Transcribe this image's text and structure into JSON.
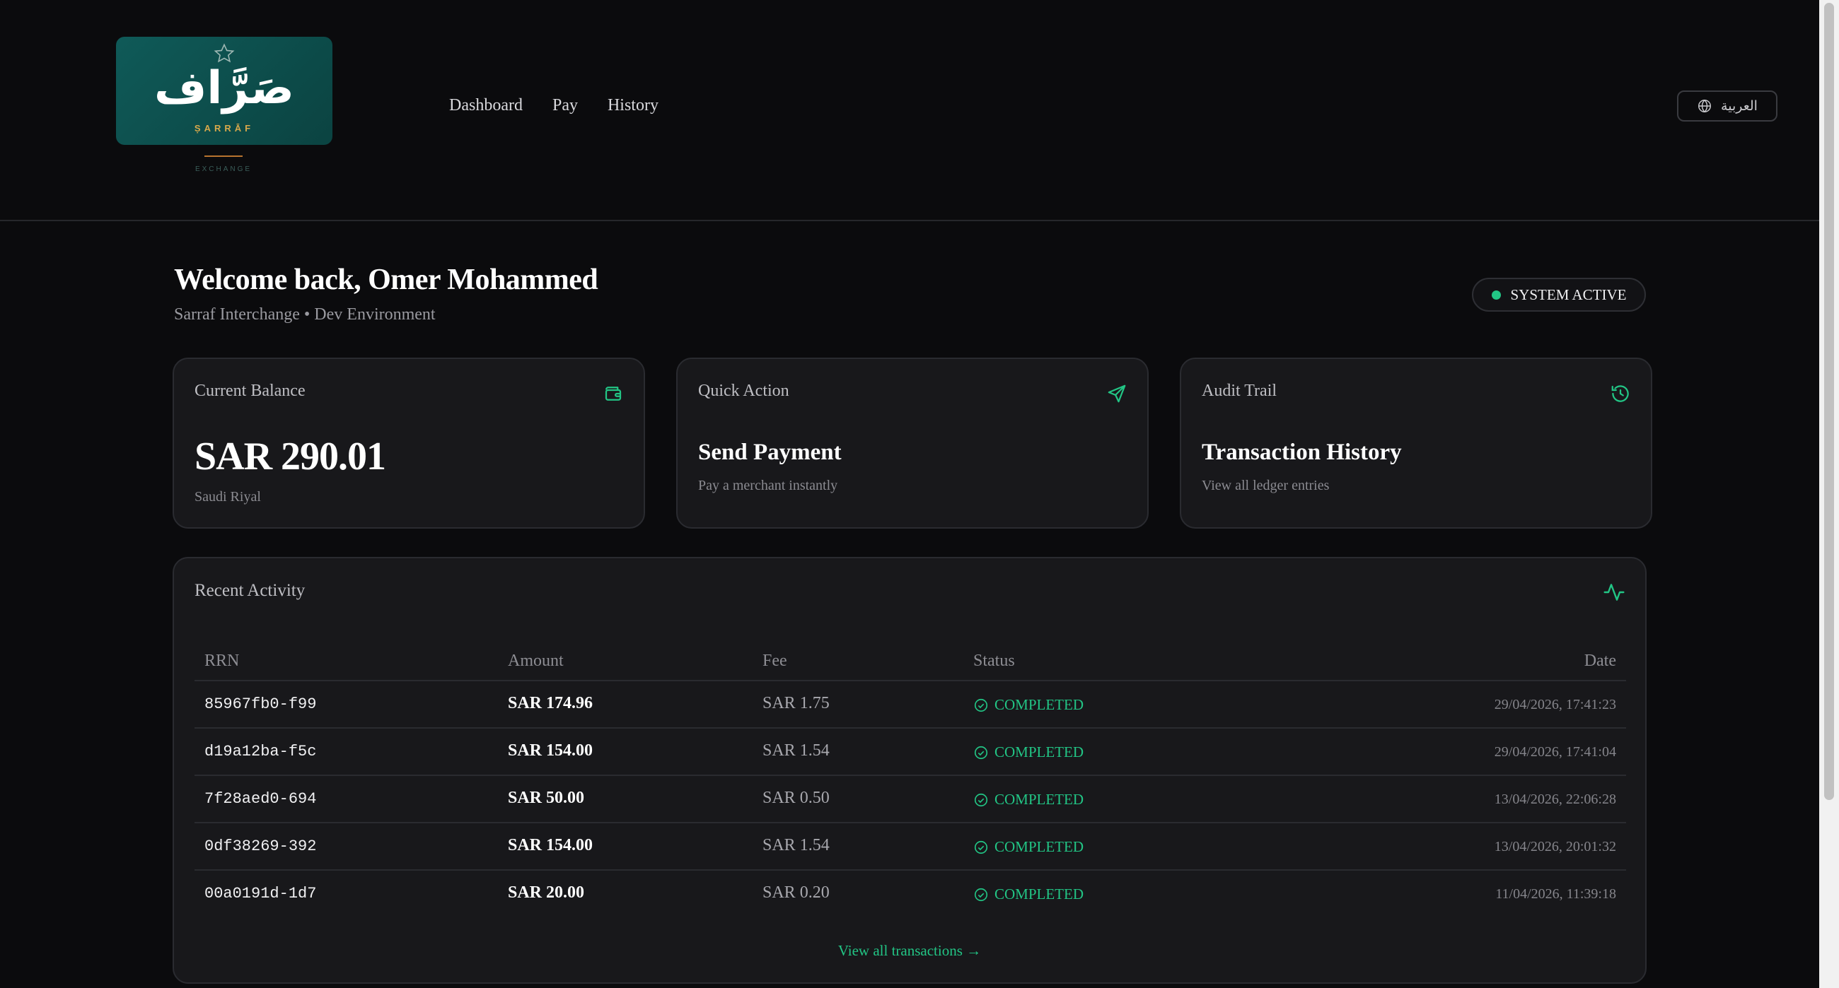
{
  "brand": {
    "arabic": "صَرَّاف",
    "latin": "ṢARRĀF",
    "tagline": "EXCHANGE",
    "card_color": "#0f5a58"
  },
  "nav": {
    "items": [
      {
        "label": "Dashboard"
      },
      {
        "label": "Pay"
      },
      {
        "label": "History"
      }
    ]
  },
  "language_button": {
    "label": "العربية",
    "icon": "globe-icon"
  },
  "welcome": {
    "title": "Welcome back, Omer Mohammed",
    "subtitle": "Sarraf Interchange • Dev Environment"
  },
  "system_status": {
    "label": "SYSTEM ACTIVE",
    "color": "#22c585"
  },
  "cards": {
    "balance": {
      "label": "Current Balance",
      "value": "SAR 290.01",
      "currency": "Saudi Riyal",
      "icon": "wallet-icon"
    },
    "quick_action": {
      "label": "Quick Action",
      "title": "Send Payment",
      "description": "Pay a merchant instantly",
      "icon": "send-icon"
    },
    "audit": {
      "label": "Audit Trail",
      "title": "Transaction History",
      "description": "View all ledger entries",
      "icon": "history-icon"
    }
  },
  "activity": {
    "title": "Recent Activity",
    "icon": "activity-icon",
    "columns": {
      "rrn": "RRN",
      "amount": "Amount",
      "fee": "Fee",
      "status": "Status",
      "date": "Date"
    },
    "rows": [
      {
        "rrn": "85967fb0-f99",
        "amount": "SAR 174.96",
        "fee": "SAR 1.75",
        "status": "COMPLETED",
        "date": "29/04/2026, 17:41:23"
      },
      {
        "rrn": "d19a12ba-f5c",
        "amount": "SAR 154.00",
        "fee": "SAR 1.54",
        "status": "COMPLETED",
        "date": "29/04/2026, 17:41:04"
      },
      {
        "rrn": "7f28aed0-694",
        "amount": "SAR 50.00",
        "fee": "SAR 0.50",
        "status": "COMPLETED",
        "date": "13/04/2026, 22:06:28"
      },
      {
        "rrn": "0df38269-392",
        "amount": "SAR 154.00",
        "fee": "SAR 1.54",
        "status": "COMPLETED",
        "date": "13/04/2026, 20:01:32"
      },
      {
        "rrn": "00a0191d-1d7",
        "amount": "SAR 20.00",
        "fee": "SAR 0.20",
        "status": "COMPLETED",
        "date": "11/04/2026, 11:39:18"
      }
    ],
    "view_all": "View all transactions →"
  },
  "colors": {
    "accent": "#22c585",
    "background": "#0b0b0d",
    "card": "#18181b"
  }
}
